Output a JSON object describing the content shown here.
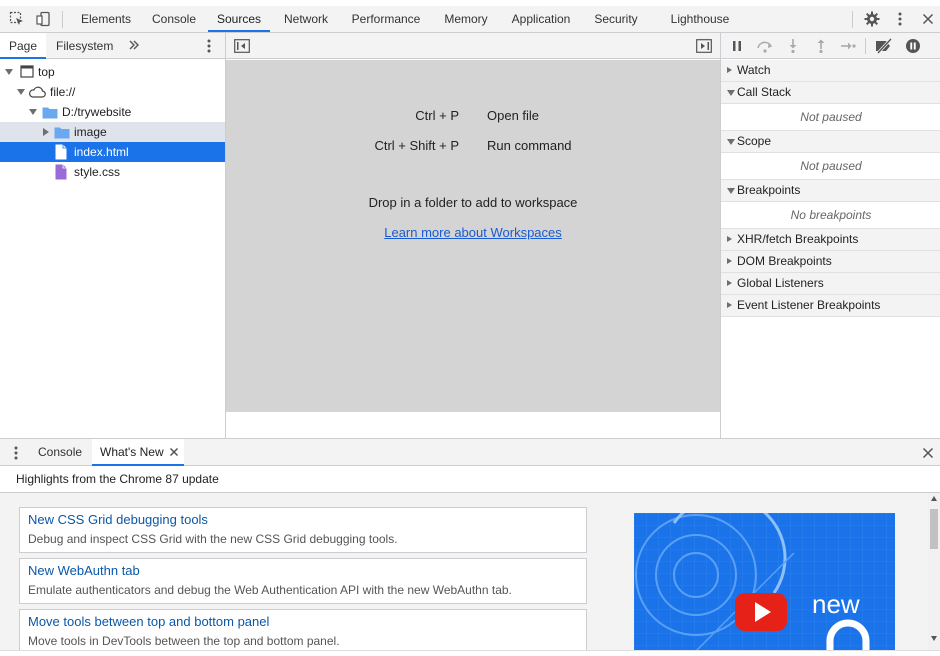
{
  "toolbar": {
    "tabs": [
      "Elements",
      "Console",
      "Sources",
      "Network",
      "Performance",
      "Memory",
      "Application",
      "Security",
      "Lighthouse"
    ],
    "active_tab": "Sources",
    "icons": [
      "inspect-element-icon",
      "device-toolbar-icon",
      "settings-gear-icon",
      "more-vertical-icon",
      "close-icon"
    ]
  },
  "navigator": {
    "tabs": [
      "Page",
      "Filesystem"
    ],
    "more_tabs_icon": "chevron-double-right-icon",
    "tree": {
      "top": "top",
      "origin": "file://",
      "folder": "D:/trywebsite",
      "subfolder": "image",
      "file_selected": "index.html",
      "file_other": "style.css"
    }
  },
  "editor": {
    "shortcuts": [
      {
        "keys": "Ctrl + P",
        "action": "Open file"
      },
      {
        "keys": "Ctrl + Shift + P",
        "action": "Run command"
      }
    ],
    "drop_hint": "Drop in a folder to add to workspace",
    "learn_link": "Learn more about Workspaces"
  },
  "debugger": {
    "sections": {
      "watch": "Watch",
      "call_stack": "Call Stack",
      "call_stack_status": "Not paused",
      "scope": "Scope",
      "scope_status": "Not paused",
      "breakpoints": "Breakpoints",
      "breakpoints_status": "No breakpoints",
      "xhr": "XHR/fetch Breakpoints",
      "dom": "DOM Breakpoints",
      "global": "Global Listeners",
      "event": "Event Listener Breakpoints"
    }
  },
  "drawer": {
    "tabs": [
      "Console",
      "What's New"
    ],
    "active_tab": "What's New",
    "highlights": "Highlights from the Chrome 87 update",
    "cards": [
      {
        "title": "New CSS Grid debugging tools",
        "desc": "Debug and inspect CSS Grid with the new CSS Grid debugging tools."
      },
      {
        "title": "New WebAuthn tab",
        "desc": "Emulate authenticators and debug the Web Authentication API with the new WebAuthn tab."
      },
      {
        "title": "Move tools between top and bottom panel",
        "desc": "Move tools in DevTools between the top and bottom panel."
      }
    ],
    "promo_text": "new"
  },
  "colors": {
    "accent": "#1a73e8",
    "selection": "#1a73e8",
    "toolbar_bg": "#f3f3f3",
    "editor_bg": "#d4d4d4",
    "folder": "#6aa8f0",
    "css_file": "#9a6bd6",
    "link": "#0b57a8"
  }
}
